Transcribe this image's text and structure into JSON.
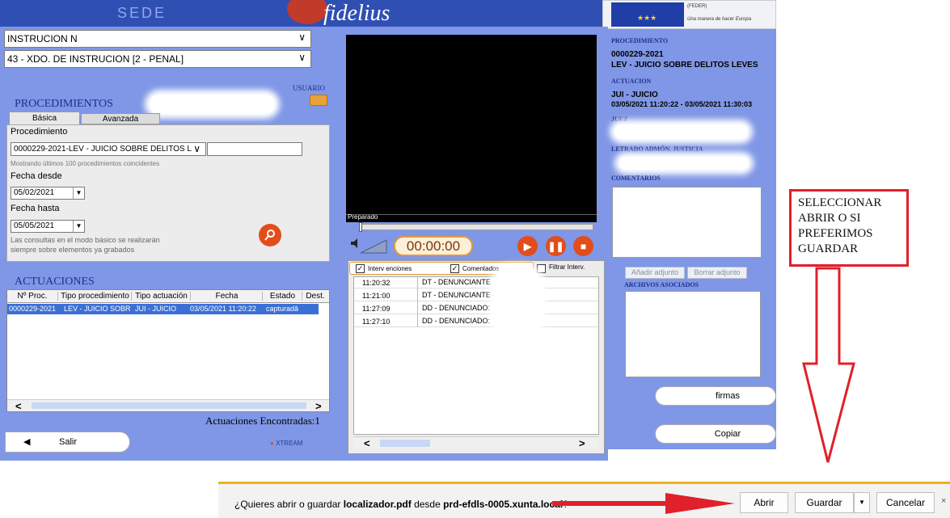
{
  "header": {
    "left_text": "SEDE",
    "logo_text": "fidelius"
  },
  "eu": {
    "line1": "(FEDER)",
    "line2": "Una manera de hacer Europa"
  },
  "left": {
    "court_select": "INSTRUCION N",
    "court_detail_select": "43 - XDO. DE INSTRUCION [2 - PENAL]",
    "usuario_label": "USUARIO",
    "procedimientos_title": "PROCEDIMIENTOS",
    "tab_basic": "Básica",
    "tab_advanced": "Avanzada",
    "procedimiento_label": "Procedimiento",
    "procedimiento_value": "0000229-2021-LEV - JUICIO SOBRE DELITOS L",
    "mostrando_text": "Mostrando últimos 100 procedimientos coincidentes",
    "fecha_desde_label": "Fecha desde",
    "fecha_desde_value": "05/02/2021",
    "fecha_hasta_label": "Fecha hasta",
    "fecha_hasta_value": "05/05/2021",
    "note_line1": "Las consultas en el modo básico se realizarán",
    "note_line2": "siempre sobre elementos ya grabados",
    "actuaciones_title": "ACTUACIONES",
    "columns": [
      "Nº Proc.",
      "Tipo procedimiento",
      "Tipo actuación",
      "Fecha",
      "Estado",
      "Dest."
    ],
    "rows": [
      {
        "proc": "0000229-2021",
        "tipo_proc": "LEV - JUICIO SOBR",
        "tipo_act": "JUI - JUICIO",
        "fecha": "03/05/2021 11:20:22",
        "estado": "capturadâ"
      }
    ],
    "found_text": "Actuaciones Encontradas:1",
    "salir_label": "Salir",
    "xtream_label": "XTREAM"
  },
  "player": {
    "status": "Preparado",
    "time": "00:00:00",
    "check_intervenciones": "Interv enciones",
    "check_comentados": "Comentados",
    "check_filtrar": "Filtrar Interv.",
    "entries": [
      {
        "time": "11:20:32",
        "text": "DT - DENUNCIANTE"
      },
      {
        "time": "11:21:00",
        "text": "DT - DENUNCIANTE·"
      },
      {
        "time": "11:27:09",
        "text": "DD - DENUNCIADO:"
      },
      {
        "time": "11:27:10",
        "text": "DD - DENUNCIADO:"
      }
    ]
  },
  "details": {
    "procedimiento_label": "PROCEDIMIENTO",
    "procedimiento_num": "0000229-2021",
    "procedimiento_desc": "LEV - JUICIO SOBRE DELITOS LEVES",
    "actuacion_label": "ACTUACION",
    "actuacion_type": "JUI - JUICIO",
    "actuacion_dates": "03/05/2021 11:20:22 - 03/05/2021 11:30:03",
    "juez_label": "JUEZ",
    "letrado_label": "LETRADO ADMÓN. JUSTICIA",
    "comentarios_label": "COMENTARIOS",
    "anadir_label": "Añadir adjunto",
    "borrar_label": "Borrar adjunto",
    "archivos_label": "ARCHIVOS ASOCIADOS",
    "firmas_label": "firmas",
    "copiar_label": "Copiar"
  },
  "annotation": {
    "text": "SELECCIONAR ABRIR O SI PREFERIMOS GUARDAR",
    "color": "#e0202a"
  },
  "download_bar": {
    "q_prefix": "¿Quieres abrir o guardar ",
    "filename": "localizador.pdf",
    "q_middle": " desde ",
    "host": "prd-efdls-0005.xunta.local",
    "q_suffix": "?",
    "abrir": "Abrir",
    "guardar": "Guardar",
    "cancelar": "Cancelar"
  },
  "colors": {
    "panel_blue": "#7f97e6",
    "selection_blue": "#3a6fd6",
    "accent_orange": "#e24d1c",
    "title_navy": "#1f2f8a"
  }
}
